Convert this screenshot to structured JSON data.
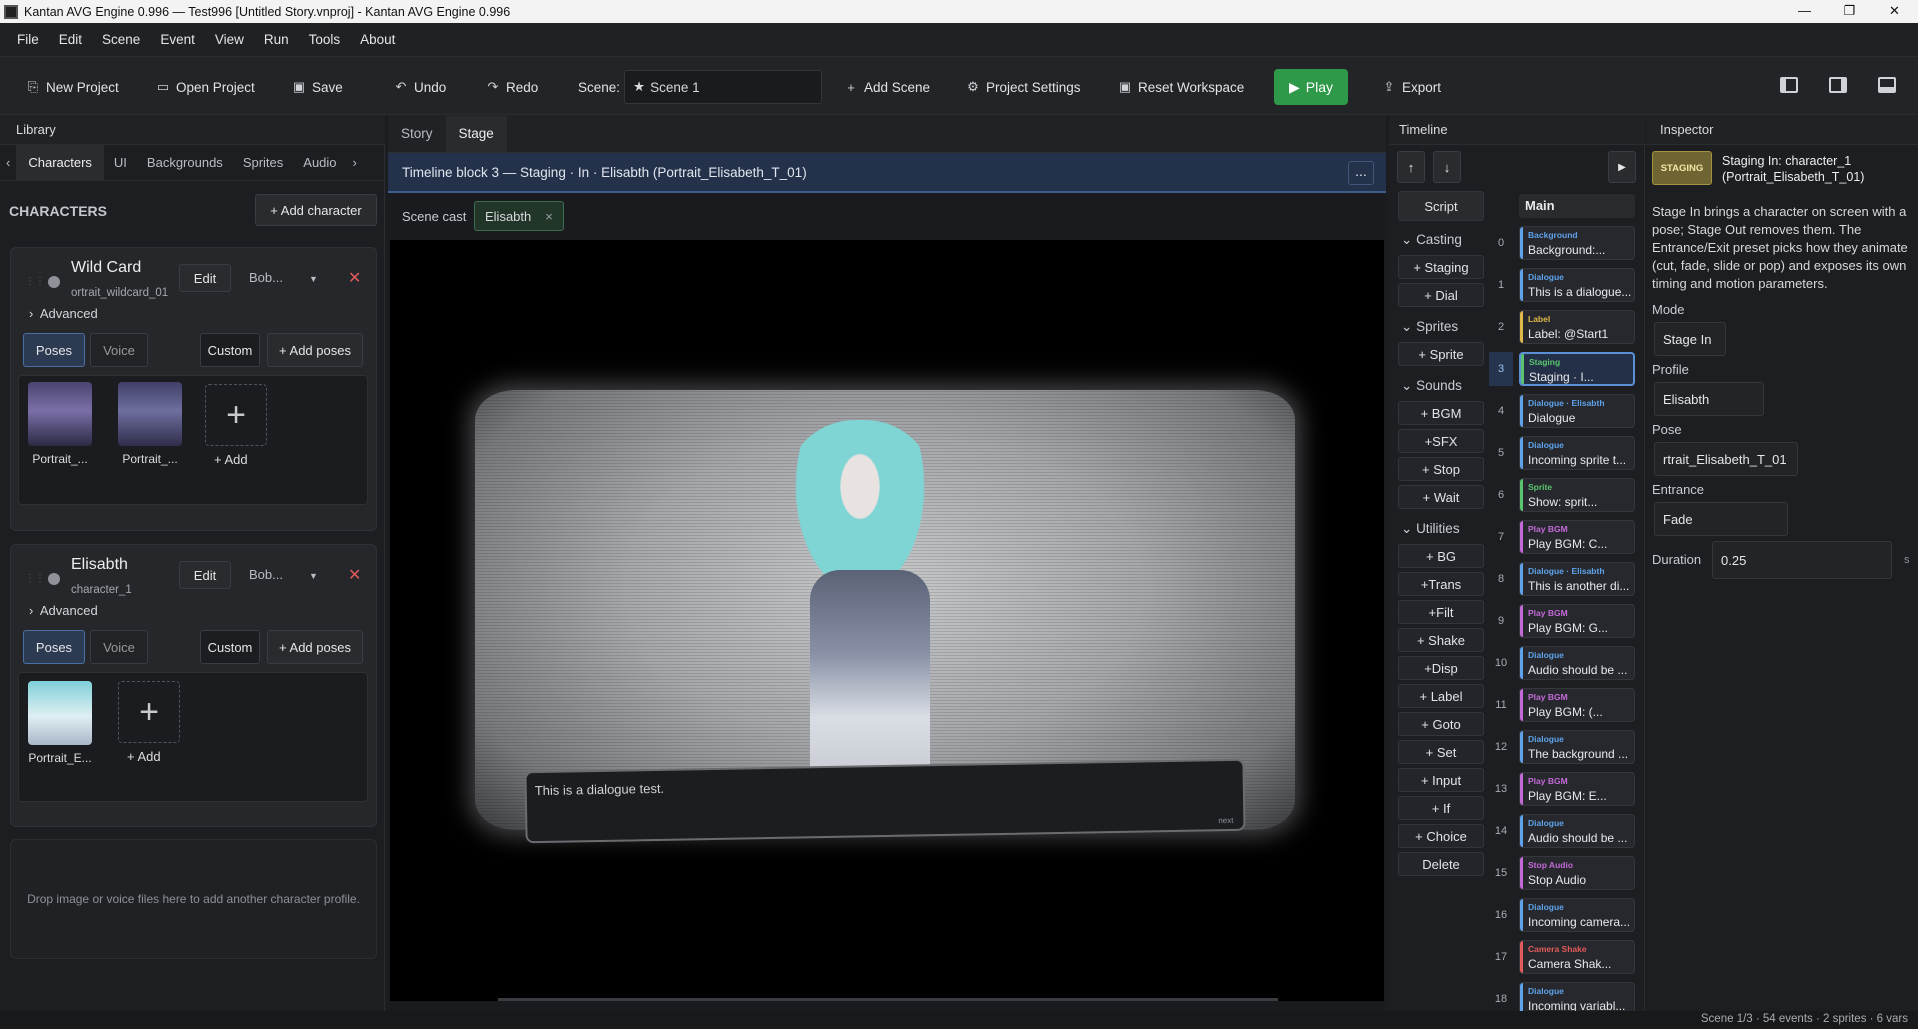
{
  "window": {
    "title": "Kantan AVG Engine 0.996 — Test996 [Untitled Story.vnproj] - Kantan AVG Engine 0.996"
  },
  "menu": [
    "File",
    "Edit",
    "Scene",
    "Event",
    "View",
    "Run",
    "Tools",
    "About"
  ],
  "toolbar": {
    "new_project": "New Project",
    "open_project": "Open Project",
    "save": "Save",
    "undo": "Undo",
    "redo": "Redo",
    "scene_label": "Scene:",
    "scene_value": "Scene 1",
    "add_scene": "Add Scene",
    "project_settings": "Project Settings",
    "reset_workspace": "Reset Workspace",
    "play": "Play",
    "export": "Export"
  },
  "library": {
    "title": "Library",
    "tabs": [
      "Characters",
      "UI",
      "Backgrounds",
      "Sprites",
      "Audio"
    ],
    "section": "CHARACTERS",
    "add_character": "+ Add character",
    "characters": [
      {
        "name": "Wild Card",
        "id": "ortrait_wildcard_01",
        "edit": "Edit",
        "voice_select": "Bob...",
        "advanced": "Advanced",
        "poses_tab": "Poses",
        "voice_tab": "Voice",
        "custom": "Custom",
        "add_poses": "+ Add poses",
        "poses": [
          "Portrait_...",
          "Portrait_..."
        ],
        "add": "+ Add"
      },
      {
        "name": "Elisabth",
        "id": "character_1",
        "edit": "Edit",
        "voice_select": "Bob...",
        "advanced": "Advanced",
        "poses_tab": "Poses",
        "voice_tab": "Voice",
        "custom": "Custom",
        "add_poses": "+ Add poses",
        "poses": [
          "Portrait_E..."
        ],
        "add": "+ Add"
      }
    ],
    "drop_hint": "Drop image or voice files here to add another character profile."
  },
  "center": {
    "tabs": [
      "Story",
      "Stage"
    ],
    "block_title": "Timeline block 3 — Staging · In · Elisabth (Portrait_Elisabeth_T_01)",
    "more": "...",
    "scene_cast_label": "Scene cast",
    "cast_chip": "Elisabth",
    "dialogue_text": "This is a dialogue test.",
    "next_marker": "next"
  },
  "timeline": {
    "title": "Timeline",
    "script_btn": "Script",
    "main_label": "Main",
    "groups": [
      {
        "name": "Casting",
        "items": [
          "+ Staging",
          "+ Dial"
        ]
      },
      {
        "name": "Sprites",
        "items": [
          "+ Sprite"
        ]
      },
      {
        "name": "Sounds",
        "items": [
          "+ BGM",
          "+SFX",
          "+ Stop",
          "+ Wait"
        ]
      },
      {
        "name": "Utilities",
        "items": [
          "+ BG",
          "+Trans",
          "+Filt",
          "+ Shake",
          "+Disp",
          "+ Label",
          "+ Goto",
          "+ Set",
          "+ Input",
          "+ If",
          "+ Choice",
          "Delete"
        ]
      }
    ],
    "events": [
      {
        "n": "0",
        "kind": "Background",
        "text": "Background:...",
        "color": "#5ea2ea"
      },
      {
        "n": "1",
        "kind": "Dialogue",
        "text": "This is a dialogue...",
        "color": "#5ea2ea"
      },
      {
        "n": "2",
        "kind": "Label",
        "text": "Label: @Start1",
        "color": "#e0b84a"
      },
      {
        "n": "3",
        "kind": "Staging",
        "text": "Staging · I...",
        "color": "#59c46d"
      },
      {
        "n": "4",
        "kind": "Dialogue · Elisabth",
        "text": "Dialogue",
        "color": "#5ea2ea"
      },
      {
        "n": "5",
        "kind": "Dialogue",
        "text": "Incoming sprite t...",
        "color": "#5ea2ea"
      },
      {
        "n": "6",
        "kind": "Sprite",
        "text": "Show: sprit...",
        "color": "#59c46d"
      },
      {
        "n": "7",
        "kind": "Play BGM",
        "text": "Play BGM: C...",
        "color": "#c46ad8"
      },
      {
        "n": "8",
        "kind": "Dialogue · Elisabth",
        "text": "This is another di...",
        "color": "#5ea2ea"
      },
      {
        "n": "9",
        "kind": "Play BGM",
        "text": "Play BGM: G...",
        "color": "#c46ad8"
      },
      {
        "n": "10",
        "kind": "Dialogue",
        "text": "Audio should be ...",
        "color": "#5ea2ea"
      },
      {
        "n": "11",
        "kind": "Play BGM",
        "text": "Play BGM: (...",
        "color": "#c46ad8"
      },
      {
        "n": "12",
        "kind": "Dialogue",
        "text": "The background ...",
        "color": "#5ea2ea"
      },
      {
        "n": "13",
        "kind": "Play BGM",
        "text": "Play BGM: E...",
        "color": "#c46ad8"
      },
      {
        "n": "14",
        "kind": "Dialogue",
        "text": "Audio should be ...",
        "color": "#5ea2ea"
      },
      {
        "n": "15",
        "kind": "Stop Audio",
        "text": "Stop Audio",
        "color": "#c46ad8"
      },
      {
        "n": "16",
        "kind": "Dialogue",
        "text": "Incoming camera...",
        "color": "#5ea2ea"
      },
      {
        "n": "17",
        "kind": "Camera Shake",
        "text": "Camera Shak...",
        "color": "#e45b5b"
      },
      {
        "n": "18",
        "kind": "Dialogue",
        "text": "Incoming variabl...",
        "color": "#5ea2ea"
      }
    ]
  },
  "inspector": {
    "title": "Inspector",
    "badge": "STAGING",
    "heading": "Staging In: character_1 (Portrait_Elisabeth_T_01)",
    "description": "Stage In brings a character on screen with a pose; Stage Out removes them. The Entrance/Exit preset picks how they animate (cut, fade, slide or pop) and exposes its own timing and motion parameters.",
    "mode_label": "Mode",
    "mode": "Stage In",
    "profile_label": "Profile",
    "profile": "Elisabth",
    "pose_label": "Pose",
    "pose": "rtrait_Elisabeth_T_01",
    "entrance_label": "Entrance",
    "entrance": "Fade",
    "duration_label": "Duration",
    "duration": "0.25",
    "duration_unit": "s"
  },
  "status": "Scene 1/3 · 54 events · 2 sprites · 6 vars"
}
